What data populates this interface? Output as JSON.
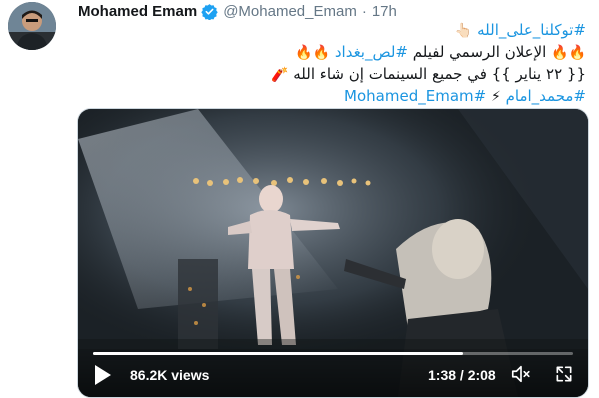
{
  "tweet": {
    "author_name": "Mohamed Emam",
    "handle": "@Mohamed_Emam",
    "separator": "·",
    "time_ago": "17h",
    "lines": [
      {
        "text": "#توكلنا_على_الله",
        "type": "hashtag",
        "emoji_after": "👆🏻"
      },
      {
        "emoji_before": "🔥🔥",
        "text": "الإعلان الرسمي لفيلم ",
        "hashtag": "#لص_بغداد",
        "emoji_after": "🔥🔥"
      },
      {
        "text": "{{ ٢٢ يناير }} في جميع السينمات إن شاء الله",
        "emoji_after": "🧨"
      },
      {
        "hashtag1": "#محمد_امام",
        "emoji": "⚡",
        "hashtag2": "#Mohamed_Emam"
      }
    ]
  },
  "video": {
    "views": "86.2K views",
    "timecode": "1:38 / 2:08",
    "progress": 0.77
  },
  "colors": {
    "link": "#1b95e0",
    "verified": "#1da1f2",
    "meta": "#657786"
  },
  "icons": [
    "verified-badge-icon",
    "play-icon",
    "volume-icon",
    "fullscreen-icon"
  ]
}
